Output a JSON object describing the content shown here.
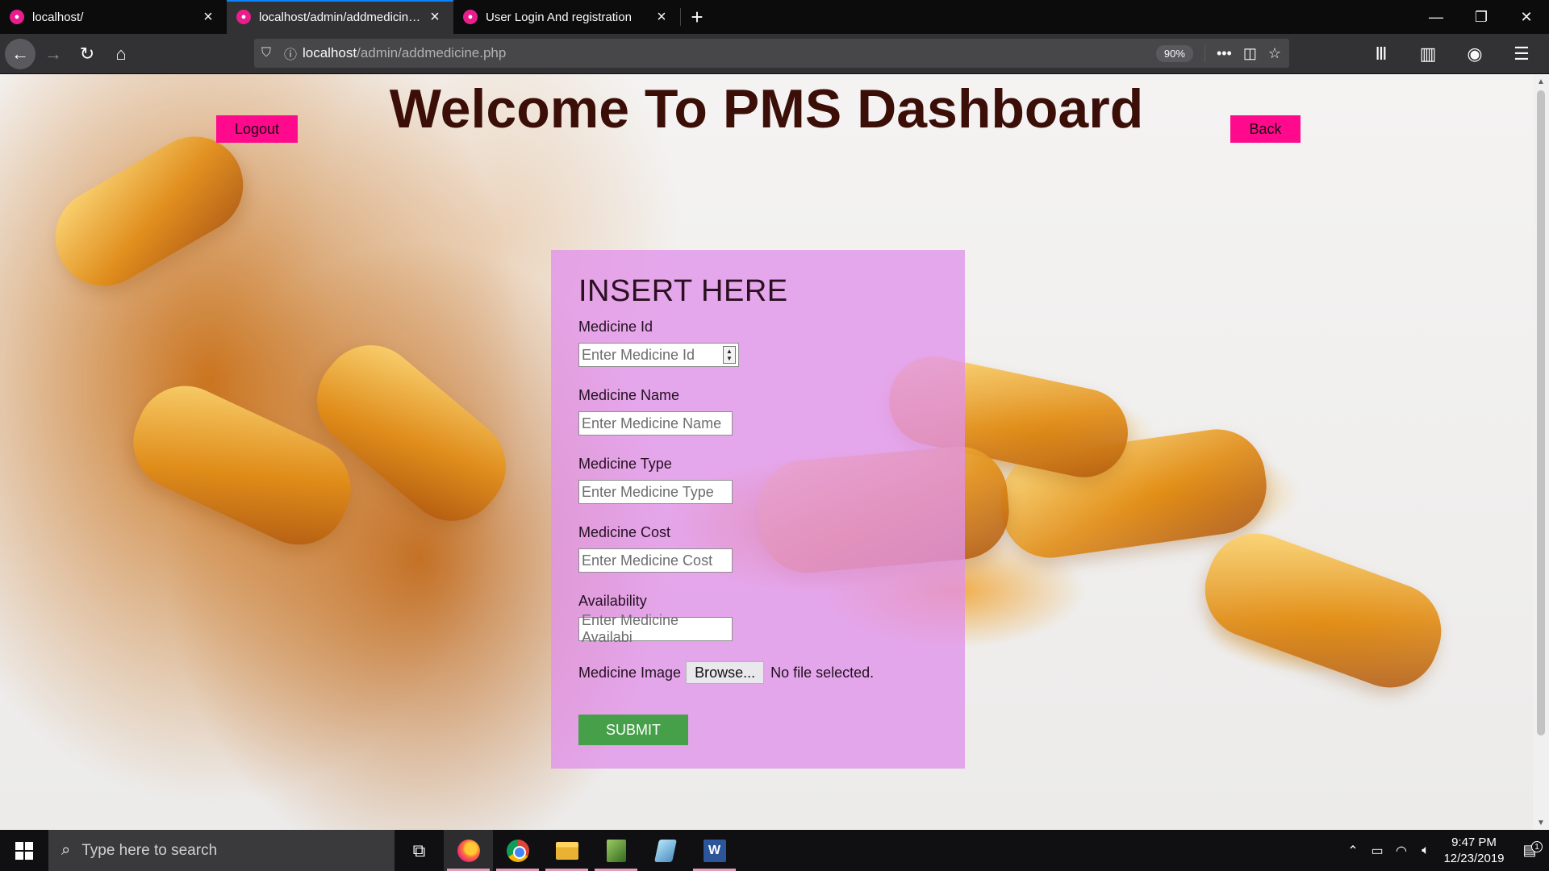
{
  "browser": {
    "tabs": [
      {
        "title": "localhost/",
        "active": false
      },
      {
        "title": "localhost/admin/addmedicine.php",
        "active": true
      },
      {
        "title": "User Login And registration",
        "active": false
      }
    ],
    "url_host": "localhost",
    "url_path": "/admin/addmedicine.php",
    "zoom": "90%"
  },
  "page": {
    "title": "Welcome To PMS Dashboard",
    "logout_label": "Logout",
    "back_label": "Back"
  },
  "form": {
    "heading": "INSERT HERE",
    "fields": [
      {
        "label": "Medicine Id",
        "placeholder": "Enter Medicine Id",
        "type": "number"
      },
      {
        "label": "Medicine Name",
        "placeholder": "Enter Medicine Name",
        "type": "text"
      },
      {
        "label": "Medicine Type",
        "placeholder": "Enter Medicine Type",
        "type": "text"
      },
      {
        "label": "Medicine Cost",
        "placeholder": "Enter Medicine Cost",
        "type": "text"
      },
      {
        "label": "Availability",
        "placeholder": "Enter Medicine Availabi",
        "type": "text"
      }
    ],
    "image_label": "Medicine Image",
    "browse_label": "Browse...",
    "file_status": "No file selected.",
    "submit_label": "SUBMIT"
  },
  "taskbar": {
    "search_placeholder": "Type here to search",
    "apps": [
      "task-view",
      "firefox",
      "chrome",
      "file-explorer",
      "spreadsheet-app",
      "tablet-app",
      "word"
    ],
    "time": "9:47 PM",
    "date": "12/23/2019",
    "notification_count": "1"
  },
  "colors": {
    "accent_pink": "#ff0a8c",
    "panel": "#e292ea",
    "submit_green": "#45a049",
    "title_color": "#3b0f08"
  }
}
